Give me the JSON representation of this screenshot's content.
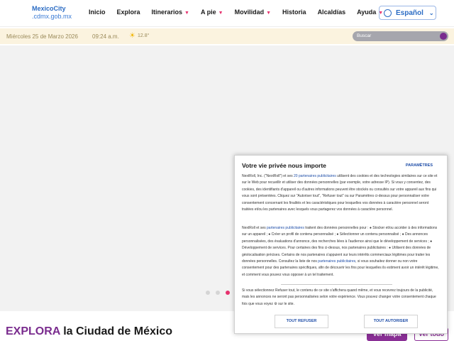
{
  "logo": {
    "line1": "MexicoCity",
    "line2": ".cdmx.gob.mx"
  },
  "nav": [
    {
      "label": "Inicio",
      "caret": ""
    },
    {
      "label": "Explora",
      "caret": ""
    },
    {
      "label": "Itinerarios",
      "caret": "▼"
    },
    {
      "label": "A pie",
      "caret": "▼"
    },
    {
      "label": "Movilidad",
      "caret": "▼"
    },
    {
      "label": "Historia",
      "caret": ""
    },
    {
      "label": "Alcaldías",
      "caret": ""
    },
    {
      "label": "Ayuda",
      "caret": "▼"
    }
  ],
  "language": {
    "label": "Español",
    "chevron": "⌄"
  },
  "infobar": {
    "date": "Miércoles 25 de Marzo 2026",
    "time": "09:24 a.m.",
    "weather_icon": "☀",
    "temp": "12.8°"
  },
  "search": {
    "placeholder": "Buscar"
  },
  "carousel": {
    "dots": 3,
    "active": 2
  },
  "headline": {
    "highlight": "EXPLORA",
    "rest": " la Ciudad de México"
  },
  "buttons": {
    "map": "Ver mapa",
    "all": "Ver todo"
  },
  "consent": {
    "title": "Votre vie privée nous importe",
    "settings": "PARAMÈTRES",
    "p1_a": "NextRoll, Inc. (\"NextRoll\") et ses ",
    "p1_link": "20 partenaires publicitaires",
    "p1_b": " utilisent des cookies et des technologies similaires sur ce site et sur le Web pour recueillir et utiliser des données personnelles (par exemple, votre adresse IP). Si vous y consentez, des cookies, des identifiants d'appareil ou d'autres informations peuvent être stockés ou consultés sur votre appareil aux fins qui vous sont présentées. Cliquez sur \"Autoriser tout\", \"Refuser tout\" ou sur Paramètres ci-dessus pour personnaliser votre consentement concernant les finalités et les caractéristiques pour lesquelles vos données à caractère personnel seront traitées et/ou les partenaires avec lesquels vous partagerez vos données à caractère personnel.",
    "p2_a": "NextRoll et ses ",
    "p2_link1": "partenaires publicitaires",
    "p2_b": " traitent des données personnelles pour : ● Stocker et/ou accéder à des informations sur un appareil ; ● Créer un profil de contenu personnalisé ; ● Sélectionner un contenu personnalisé ; ● Des annonces personnalisées, des évaluations d'annonce, des recherches liées à l'audience ainsi que le développement de services ; ● Développement de services. Pour certaines des fins ci-dessus, nos partenaires publicitaires : ● Utilisent des données de géolocalisation précises. Certains de nos partenaires s'appuient sur leurs intérêts commerciaux légitimes pour traiter les données personnelles. Consultez la liste de nos ",
    "p2_link2": "partenaires publicitaires",
    "p2_c": ", si vous souhaitez donner ou non votre consentement pour des partenaires spécifiques, afin de découvrir les fins pour lesquelles ils estiment avoir un intérêt légitime, et comment vous pouvez vous opposer à un tel traitement.",
    "p3_a": "Si vous sélectionnez Refuser tout, le contenu de ce site s'affichera quand même, et vous recevrez toujours de la publicité, mais les annonces ne seront pas personnalisées selon votre expérience. Vous pouvez changer votre consentement chaque fois que vous voyez ",
    "p3_icon": "⚙",
    "p3_b": " sur le site.",
    "refuse": "TOUT REFUSER",
    "accept": "TOUT AUTORISER"
  }
}
